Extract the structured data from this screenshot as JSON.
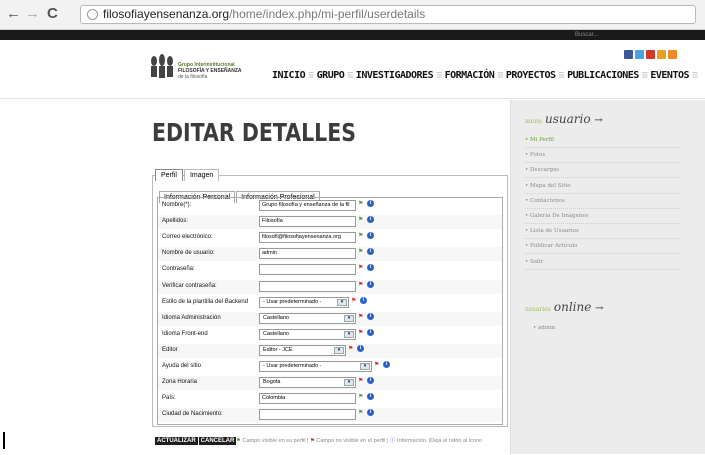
{
  "browser": {
    "url_host": "filosofiayensenanza.org",
    "url_path": "/home/index.php/mi-perfil/userdetails",
    "back_glyph": "←",
    "forward_glyph": "→",
    "reload_glyph": "C"
  },
  "topbar": {
    "search_label": "Buscar..."
  },
  "logo": {
    "line1": "Grupo Interinstitucional",
    "line2": "FILOSOFÍA Y ENSEÑANZA",
    "line3": "de la filosofía"
  },
  "nav": [
    "INICIO",
    "GRUPO",
    "INVESTIGADORES",
    "FORMACIÓN",
    "PROYECTOS",
    "PUBLICACIONES",
    "EVENTOS"
  ],
  "social_icons": [
    "facebook-icon",
    "twitter-icon",
    "youtube-icon",
    "flickr-icon",
    "rss-icon"
  ],
  "social_colors": [
    "#3b5998",
    "#4aa3df",
    "#d03a2a",
    "#e8a020",
    "#f08a24"
  ],
  "page_title": "EDITAR DETALLES",
  "tabs": [
    "Perfil",
    "Imagen"
  ],
  "subtabs": [
    "Información Personal",
    "Información Profesional"
  ],
  "fields": [
    {
      "label": "Nombre(*):",
      "type": "text",
      "value": "Grupo filosofía y enseñanza de la fil",
      "vis": "green"
    },
    {
      "label": "Apellidos:",
      "type": "text",
      "value": "Filosofía",
      "vis": "green"
    },
    {
      "label": "Correo electrónico:",
      "type": "text",
      "value": "filosofi@filosofiayensenanza.org",
      "vis": "green"
    },
    {
      "label": "Nombre de usuario:",
      "type": "text",
      "value": "admin",
      "vis": "green"
    },
    {
      "label": "Contraseña:",
      "type": "text",
      "value": "",
      "vis": "red"
    },
    {
      "label": "Verificar contraseña:",
      "type": "text",
      "value": "",
      "vis": "red"
    },
    {
      "label": "Estilo de la plantilla del Backend",
      "type": "select",
      "value": "- Usar predeterminado -",
      "vis": "red",
      "w": 90
    },
    {
      "label": "Idioma Administración",
      "type": "select",
      "value": "Castellano",
      "vis": "red",
      "w": 97
    },
    {
      "label": "Idioma Front-end",
      "type": "select",
      "value": "Castellano",
      "vis": "red",
      "w": 97
    },
    {
      "label": "Editor",
      "type": "select",
      "value": "Editor - JCE",
      "vis": "red",
      "w": 87
    },
    {
      "label": "Ayuda del sitio",
      "type": "select",
      "value": "- Usar predeterminado -",
      "vis": "red",
      "w": 113
    },
    {
      "label": "Zona Horaria",
      "type": "select",
      "value": "Bogota",
      "vis": "red",
      "w": 97
    },
    {
      "label": "País:",
      "type": "text",
      "value": "Colombia",
      "vis": "green"
    },
    {
      "label": "Ciudad de Nacimiento:",
      "type": "text",
      "value": "",
      "vis": "green"
    }
  ],
  "buttons": {
    "save": "ACTUALIZAR",
    "cancel": "CANCELAR"
  },
  "legend": {
    "visible": "Campo visible en su perfil |",
    "hidden": "Campo no visible en el perfil |",
    "info": "Información. |Deja el ratón al icono"
  },
  "sidebar": {
    "menu_prefix": "menu",
    "user_title": "usuario",
    "user_items": [
      "Mi Perfil",
      "Fotos",
      "Descargas",
      "Mapa del Sitio",
      "Contáctenos",
      "Galería De Imágenes",
      "Lista de Usuarios",
      "Publicar Artículo",
      "Salir"
    ],
    "online_prefix": "usuarios",
    "online_title": "online",
    "online_users": [
      "admin"
    ],
    "arrow": "→"
  }
}
